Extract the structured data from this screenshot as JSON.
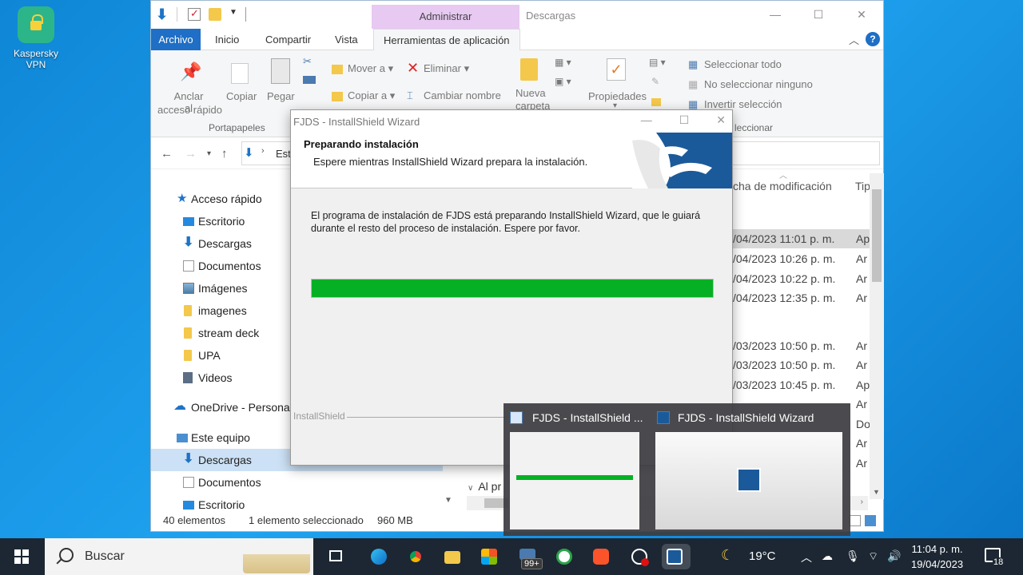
{
  "desktop": {
    "icon_label_1": "Kaspersky",
    "icon_label_2": "VPN"
  },
  "explorer": {
    "context_tab": "Administrar",
    "title": "Descargas",
    "tabs": {
      "file": "Archivo",
      "home": "Inicio",
      "share": "Compartir",
      "view": "Vista",
      "tools": "Herramientas de aplicación"
    },
    "ribbon": {
      "pin_line1": "Anclar al",
      "pin_line2": "acceso rápido",
      "copy": "Copiar",
      "paste": "Pegar",
      "move_to": "Mover a",
      "copy_to": "Copiar a",
      "delete": "Eliminar",
      "rename": "Cambiar nombre",
      "new_folder_line1": "Nueva",
      "new_folder_line2": "carpeta",
      "properties": "Propiedades",
      "select_all": "Seleccionar todo",
      "select_none": "No seleccionar ninguno",
      "invert": "Invertir selección",
      "group_clipboard": "Portapapeles",
      "group_select": "leccionar"
    },
    "address_text": "Est",
    "nav": [
      {
        "label": "Acceso rápido"
      },
      {
        "label": "Escritorio"
      },
      {
        "label": "Descargas"
      },
      {
        "label": "Documentos"
      },
      {
        "label": "Imágenes"
      },
      {
        "label": "imagenes"
      },
      {
        "label": "stream deck"
      },
      {
        "label": "UPA"
      },
      {
        "label": "Videos"
      },
      {
        "label": "OneDrive - Personal"
      },
      {
        "label": "Este equipo"
      },
      {
        "label": "Descargas"
      },
      {
        "label": "Documentos"
      },
      {
        "label": "Escritorio"
      }
    ],
    "columns": {
      "modified": "cha de modificación",
      "type": "Tip"
    },
    "files": [
      {
        "date": "/04/2023 11:01 p. m.",
        "type": "Ap"
      },
      {
        "date": "/04/2023 10:26 p. m.",
        "type": "Ar"
      },
      {
        "date": "/04/2023 10:22 p. m.",
        "type": "Ar"
      },
      {
        "date": "/04/2023 12:35 p. m.",
        "type": "Ar"
      },
      {
        "date": "/03/2023 10:50 p. m.",
        "type": "Ar"
      },
      {
        "date": "/03/2023 10:50 p. m.",
        "type": "Ar"
      },
      {
        "date": "/03/2023 10:45 p. m.",
        "type": "Ap"
      },
      {
        "date": "",
        "type": "Ar"
      },
      {
        "date": "",
        "type": "Do"
      },
      {
        "date": "",
        "type": "Ar"
      },
      {
        "date": "",
        "type": "Ar"
      }
    ],
    "group_header": "Al pr",
    "status": {
      "count": "40 elementos",
      "selection": "1 elemento seleccionado",
      "size": "960 MB"
    }
  },
  "dialog": {
    "title": "FJDS - InstallShield Wizard",
    "heading": "Preparando instalación",
    "subheading": "Espere mientras InstallShield Wizard prepara la instalación.",
    "message": "El programa de instalación de FJDS está preparando InstallShield Wizard, que le guiará durante el resto del proceso de instalación. Espere por favor.",
    "progress_percent": 100,
    "brand": "InstallShield",
    "progress_color": "#06b025"
  },
  "thumbnails": [
    {
      "title": "FJDS - InstallShield ..."
    },
    {
      "title": "FJDS - InstallShield Wizard"
    }
  ],
  "taskbar": {
    "search_placeholder": "Buscar",
    "badge": "99+",
    "temperature": "19°C",
    "time": "11:04 p. m.",
    "date": "19/04/2023",
    "notifications": "18"
  }
}
